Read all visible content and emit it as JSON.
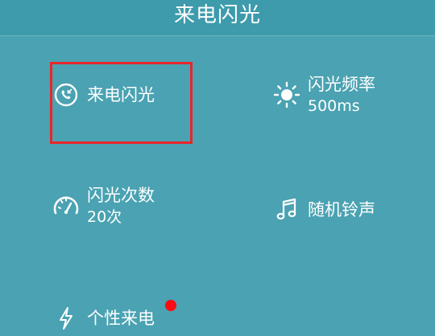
{
  "header": {
    "title": "来电闪光"
  },
  "tiles": [
    {
      "label": "来电闪光",
      "value": "",
      "icon": "incoming-call-icon"
    },
    {
      "label": "闪光频率",
      "value": "500ms",
      "icon": "sun-icon"
    },
    {
      "label": "闪光次数",
      "value": "20次",
      "icon": "speedometer-icon"
    },
    {
      "label": "随机铃声",
      "value": "",
      "icon": "music-note-icon"
    },
    {
      "label": "个性来电",
      "value": "",
      "icon": "lightning-icon"
    }
  ],
  "colors": {
    "background": "#4aa2b2",
    "header": "#3d9bac",
    "highlight_border": "#e8262b",
    "badge_dot": "#ff0a12",
    "text": "#ffffff"
  }
}
